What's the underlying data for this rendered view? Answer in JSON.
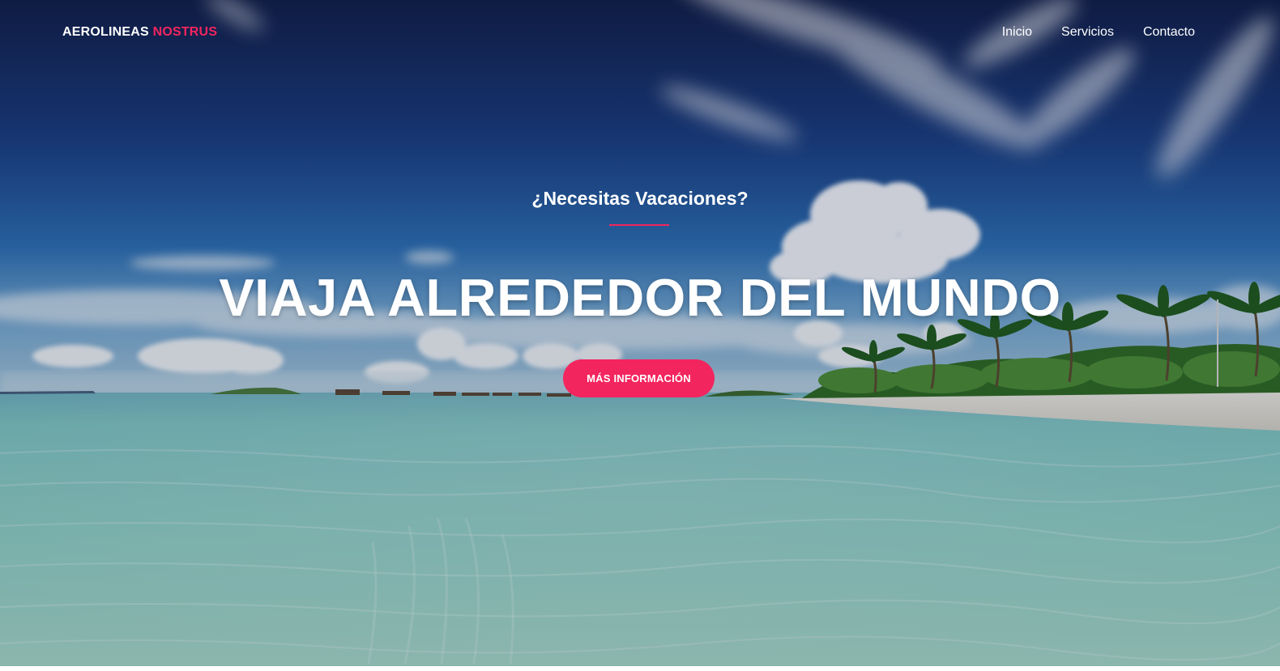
{
  "brand": {
    "part1": "AEROLINEAS",
    "part2": "NOSTRUS"
  },
  "nav": {
    "items": [
      {
        "label": "Inicio"
      },
      {
        "label": "Servicios"
      },
      {
        "label": "Contacto"
      }
    ]
  },
  "hero": {
    "subtitle": "¿Necesitas Vacaciones?",
    "headline": "VIAJA ALREDEDOR DEL MUNDO",
    "cta_label": "MÁS INFORMACIÓN"
  },
  "colors": {
    "accent": "#f3255e",
    "sky_top": "#142452",
    "sky_mid": "#2a63a8",
    "sea": "#8fd3cc",
    "sand": "#e4e2dc",
    "palms": "#3a7a2a"
  },
  "background": {
    "description_icon": "tropical-beach-image"
  }
}
